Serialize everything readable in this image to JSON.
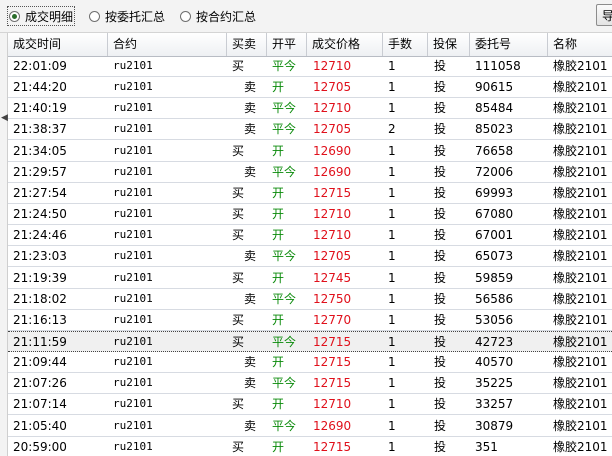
{
  "tabs": {
    "detail": "成交明细",
    "by_order": "按委托汇总",
    "by_contract": "按合约汇总"
  },
  "corner_button": "导",
  "headers": [
    "成交时间",
    "合约",
    "买卖",
    "开平",
    "成交价格",
    "手数",
    "投保",
    "委托号",
    "名称"
  ],
  "rows": [
    {
      "time": "22:01:09",
      "contract": "ru2101",
      "side": "买",
      "oc": "平今",
      "price": "12710",
      "qty": "1",
      "hedge": "投",
      "order": "111058",
      "name": "橡胶2101"
    },
    {
      "time": "21:44:20",
      "contract": "ru2101",
      "side": "卖",
      "oc": "开",
      "price": "12705",
      "qty": "1",
      "hedge": "投",
      "order": "90615",
      "name": "橡胶2101"
    },
    {
      "time": "21:40:19",
      "contract": "ru2101",
      "side": "卖",
      "oc": "平今",
      "price": "12710",
      "qty": "1",
      "hedge": "投",
      "order": "85484",
      "name": "橡胶2101"
    },
    {
      "time": "21:38:37",
      "contract": "ru2101",
      "side": "卖",
      "oc": "平今",
      "price": "12705",
      "qty": "2",
      "hedge": "投",
      "order": "85023",
      "name": "橡胶2101"
    },
    {
      "time": "21:34:05",
      "contract": "ru2101",
      "side": "买",
      "oc": "开",
      "price": "12690",
      "qty": "1",
      "hedge": "投",
      "order": "76658",
      "name": "橡胶2101"
    },
    {
      "time": "21:29:57",
      "contract": "ru2101",
      "side": "卖",
      "oc": "平今",
      "price": "12690",
      "qty": "1",
      "hedge": "投",
      "order": "72006",
      "name": "橡胶2101"
    },
    {
      "time": "21:27:54",
      "contract": "ru2101",
      "side": "买",
      "oc": "开",
      "price": "12715",
      "qty": "1",
      "hedge": "投",
      "order": "69993",
      "name": "橡胶2101"
    },
    {
      "time": "21:24:50",
      "contract": "ru2101",
      "side": "买",
      "oc": "开",
      "price": "12710",
      "qty": "1",
      "hedge": "投",
      "order": "67080",
      "name": "橡胶2101"
    },
    {
      "time": "21:24:46",
      "contract": "ru2101",
      "side": "买",
      "oc": "开",
      "price": "12710",
      "qty": "1",
      "hedge": "投",
      "order": "67001",
      "name": "橡胶2101"
    },
    {
      "time": "21:23:03",
      "contract": "ru2101",
      "side": "卖",
      "oc": "平今",
      "price": "12705",
      "qty": "1",
      "hedge": "投",
      "order": "65073",
      "name": "橡胶2101"
    },
    {
      "time": "21:19:39",
      "contract": "ru2101",
      "side": "买",
      "oc": "开",
      "price": "12745",
      "qty": "1",
      "hedge": "投",
      "order": "59859",
      "name": "橡胶2101"
    },
    {
      "time": "21:18:02",
      "contract": "ru2101",
      "side": "卖",
      "oc": "平今",
      "price": "12750",
      "qty": "1",
      "hedge": "投",
      "order": "56586",
      "name": "橡胶2101"
    },
    {
      "time": "21:16:13",
      "contract": "ru2101",
      "side": "买",
      "oc": "开",
      "price": "12770",
      "qty": "1",
      "hedge": "投",
      "order": "53056",
      "name": "橡胶2101"
    },
    {
      "time": "21:11:59",
      "contract": "ru2101",
      "side": "买",
      "oc": "平今",
      "price": "12715",
      "qty": "1",
      "hedge": "投",
      "order": "42723",
      "name": "橡胶2101"
    },
    {
      "time": "21:09:44",
      "contract": "ru2101",
      "side": "卖",
      "oc": "开",
      "price": "12715",
      "qty": "1",
      "hedge": "投",
      "order": "40570",
      "name": "橡胶2101"
    },
    {
      "time": "21:07:26",
      "contract": "ru2101",
      "side": "卖",
      "oc": "平今",
      "price": "12715",
      "qty": "1",
      "hedge": "投",
      "order": "35225",
      "name": "橡胶2101"
    },
    {
      "time": "21:07:14",
      "contract": "ru2101",
      "side": "买",
      "oc": "开",
      "price": "12710",
      "qty": "1",
      "hedge": "投",
      "order": "33257",
      "name": "橡胶2101"
    },
    {
      "time": "21:05:40",
      "contract": "ru2101",
      "side": "卖",
      "oc": "平今",
      "price": "12690",
      "qty": "1",
      "hedge": "投",
      "order": "30879",
      "name": "橡胶2101"
    },
    {
      "time": "20:59:00",
      "contract": "ru2101",
      "side": "买",
      "oc": "开",
      "price": "12715",
      "qty": "1",
      "hedge": "投",
      "order": "351",
      "name": "橡胶2101"
    }
  ],
  "selected_row_index": 13,
  "colors": {
    "open_close": "#0a8a0a",
    "price": "#e0101b"
  },
  "icons": {
    "left_edge": "left-triangle-icon",
    "radio": "radio-button-icon"
  }
}
